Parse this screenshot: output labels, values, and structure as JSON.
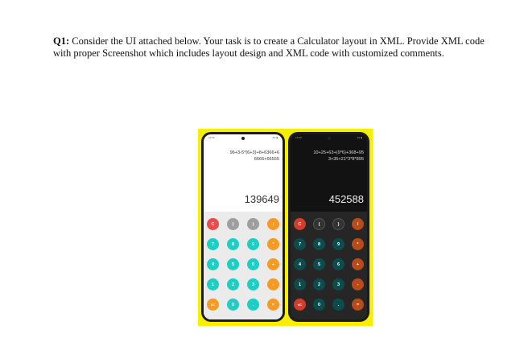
{
  "question": {
    "label": "Q1:",
    "text": " Consider the UI attached below. Your task is to create a Calculator layout in XML. Provide XML code with proper Screenshot which includes layout design and XML code with customized comments."
  },
  "colors": {
    "figure_background": "#f7ef00",
    "light_red": "#ea4a4a",
    "light_orange": "#f59a23",
    "light_teal": "#1ccfc4",
    "dark_orange": "#b94a1a",
    "dark_teal": "#0d4c4c"
  },
  "phone_light": {
    "status_left": "12:00",
    "status_right": "4G ▮",
    "expression_line1": "96+3-5*(6+3)+8+6366+6",
    "expression_line2": "6666+66555",
    "result": "139649",
    "keys": [
      [
        {
          "label": "C",
          "color": "red"
        },
        {
          "label": "(",
          "color": "gray"
        },
        {
          "label": ")",
          "color": "gray"
        },
        {
          "label": "/",
          "color": "orange"
        }
      ],
      [
        {
          "label": "7",
          "color": "teal"
        },
        {
          "label": "8",
          "color": "teal"
        },
        {
          "label": "9",
          "color": "teal"
        },
        {
          "label": "*",
          "color": "orange"
        }
      ],
      [
        {
          "label": "4",
          "color": "teal"
        },
        {
          "label": "5",
          "color": "teal"
        },
        {
          "label": "6",
          "color": "teal"
        },
        {
          "label": "+",
          "color": "orange"
        }
      ],
      [
        {
          "label": "1",
          "color": "teal"
        },
        {
          "label": "2",
          "color": "teal"
        },
        {
          "label": "3",
          "color": "teal"
        },
        {
          "label": "-",
          "color": "orange"
        }
      ],
      [
        {
          "label": "AC",
          "color": "orange"
        },
        {
          "label": "0",
          "color": "teal"
        },
        {
          "label": ".",
          "color": "teal"
        },
        {
          "label": "=",
          "color": "orange"
        }
      ]
    ]
  },
  "phone_dark": {
    "status_left": "12:00",
    "status_right": "4G ▮",
    "expression_line1": "10+25+63+(9*6)+368+95",
    "expression_line2": "3+35+21*3*8*895",
    "result": "452588",
    "keys": [
      [
        {
          "label": "C",
          "color": "red"
        },
        {
          "label": "(",
          "color": "gray"
        },
        {
          "label": ")",
          "color": "gray"
        },
        {
          "label": "/",
          "color": "orange"
        }
      ],
      [
        {
          "label": "7",
          "color": "teal"
        },
        {
          "label": "8",
          "color": "teal"
        },
        {
          "label": "9",
          "color": "teal"
        },
        {
          "label": "*",
          "color": "orange"
        }
      ],
      [
        {
          "label": "4",
          "color": "teal"
        },
        {
          "label": "5",
          "color": "teal"
        },
        {
          "label": "6",
          "color": "teal"
        },
        {
          "label": "+",
          "color": "orange"
        }
      ],
      [
        {
          "label": "1",
          "color": "teal"
        },
        {
          "label": "2",
          "color": "teal"
        },
        {
          "label": "3",
          "color": "teal"
        },
        {
          "label": "-",
          "color": "orange"
        }
      ],
      [
        {
          "label": "AC",
          "color": "red"
        },
        {
          "label": "0",
          "color": "teal"
        },
        {
          "label": ".",
          "color": "teal"
        },
        {
          "label": "=",
          "color": "orange"
        }
      ]
    ]
  }
}
